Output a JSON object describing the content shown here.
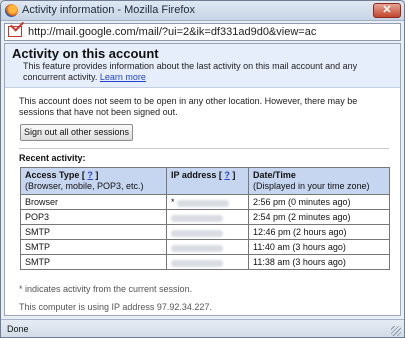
{
  "window": {
    "title": "Activity information - Mozilla Firefox",
    "close_label": "✕",
    "url": "http://mail.google.com/mail/?ui=2&ik=df331ad9d0&view=ac"
  },
  "header": {
    "heading": "Activity on this account",
    "description": "This feature provides information about the last activity on this mail account and any concurrent activity.",
    "learn_more": "Learn more"
  },
  "intro": "This account does not seem to be open in any other location. However, there may be sessions that have not been signed out.",
  "signout_button": "Sign out all other sessions",
  "recent_label": "Recent activity:",
  "table": {
    "col1_title": "Access Type",
    "col1_help": "?",
    "col1_sub": "(Browser, mobile, POP3, etc.)",
    "col2_title": "IP address",
    "col2_help": "?",
    "col3_title": "Date/Time",
    "col3_sub": "(Displayed in your time zone)",
    "rows": [
      {
        "type": "Browser",
        "star": "*",
        "datetime": "2:56 pm (0 minutes ago)"
      },
      {
        "type": "POP3",
        "star": "",
        "datetime": "2:54 pm (2 minutes ago)"
      },
      {
        "type": "SMTP",
        "star": "",
        "datetime": "12:46 pm (2 hours ago)"
      },
      {
        "type": "SMTP",
        "star": "",
        "datetime": "11:40 am (3 hours ago)"
      },
      {
        "type": "SMTP",
        "star": "",
        "datetime": "11:38 am (3 hours ago)"
      }
    ]
  },
  "footnote": "* indicates activity from the current session.",
  "ip_note": "This computer is using IP address 97.92.34.227.",
  "status": "Done"
}
